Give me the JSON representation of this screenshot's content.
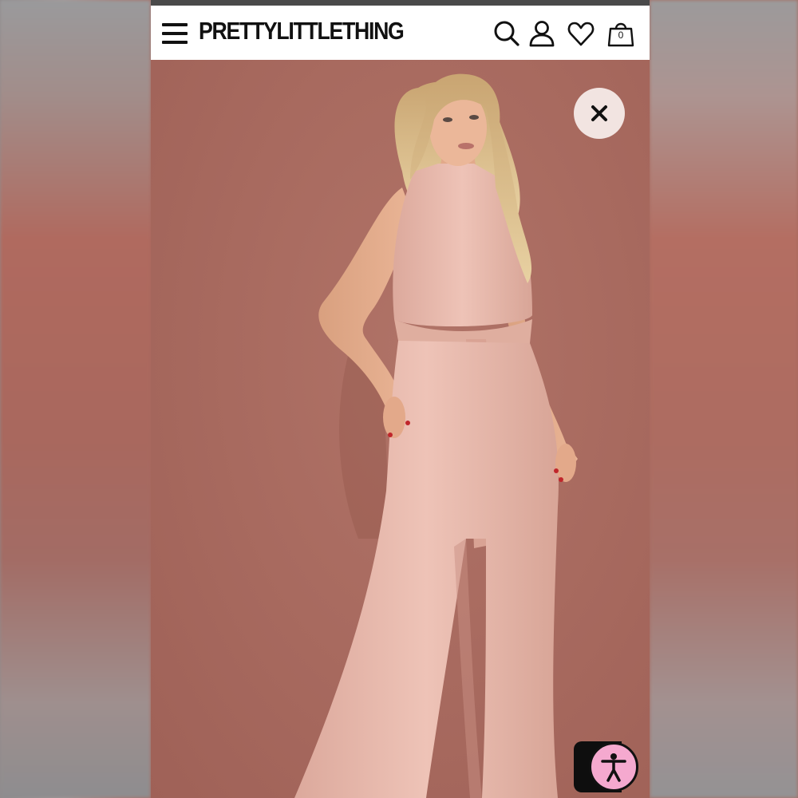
{
  "header": {
    "brand": "PRETTYLITTLETHING",
    "bag_count": "0"
  },
  "icons": {
    "menu": "hamburger-menu-icon",
    "search": "search-icon",
    "account": "user-icon",
    "wishlist": "heart-icon",
    "bag": "shopping-bag-icon",
    "close": "close-icon",
    "accessibility": "accessibility-icon"
  },
  "product_image": {
    "subject": "Model in blush pink halter neck belted flared jumpsuit"
  },
  "colors": {
    "background": "#a86a60",
    "jumpsuit": "#e6b8ac",
    "close_button": "#f2e4e1",
    "accessibility_button": "#f5a9cf"
  }
}
